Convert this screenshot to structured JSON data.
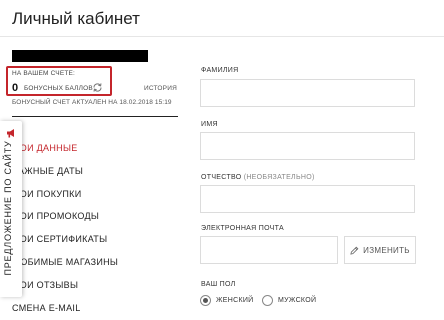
{
  "page": {
    "title": "Личный кабинет"
  },
  "bonus": {
    "label": "НА ВАШЕМ СЧЕТЕ:",
    "value": "0",
    "unit": "БОНУСНЫХ БАЛЛОВ",
    "history_link": "ИСТОРИЯ",
    "note": "БОНУСНЫЙ СЧЕТ АКТУАЛЕН НА 18.02.2018 15:19",
    "icon": "refresh-icon"
  },
  "menu": {
    "items": [
      {
        "label": "МОИ ДАННЫЕ",
        "active": true
      },
      {
        "label": "ВАЖНЫЕ ДАТЫ"
      },
      {
        "label": "МОИ ПОКУПКИ"
      },
      {
        "label": "МОИ ПРОМОКОДЫ"
      },
      {
        "label": "МОИ СЕРТИФИКАТЫ"
      },
      {
        "label": "ЛЮБИМЫЕ МАГАЗИНЫ"
      },
      {
        "label": "МОИ ОТЗЫВЫ"
      },
      {
        "label": "СМЕНА E-MAIL"
      }
    ]
  },
  "side_tab": {
    "label": "ПРЕДЛОЖЕНИЕ ПО САЙТУ",
    "icon": "megaphone-icon"
  },
  "form": {
    "last_name": {
      "label": "ФАМИЛИЯ",
      "value": ""
    },
    "first_name": {
      "label": "ИМЯ",
      "value": ""
    },
    "middle_name": {
      "label": "ОТЧЕСТВО",
      "hint": "(НЕОБЯЗАТЕЛЬНО)",
      "value": ""
    },
    "email": {
      "label": "ЭЛЕКТРОННАЯ ПОЧТА",
      "value": "",
      "change_label": "ИЗМЕНИТЬ",
      "change_icon": "pencil-icon"
    },
    "gender": {
      "label": "ВАШ ПОЛ",
      "options": [
        "ЖЕНСКИЙ",
        "МУЖСКОЙ"
      ],
      "selected": "ЖЕНСКИЙ"
    }
  },
  "colors": {
    "accent": "#c4252b",
    "border": "#dcdcdc"
  }
}
